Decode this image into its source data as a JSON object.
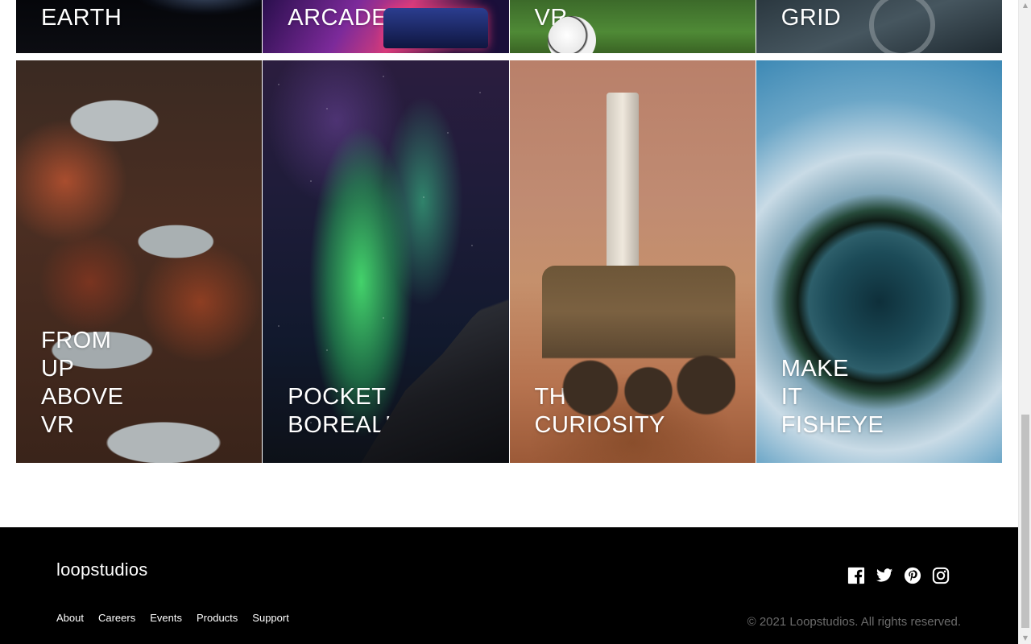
{
  "creations": {
    "top_row": [
      {
        "title": "EARTH"
      },
      {
        "title": "ARCADE"
      },
      {
        "title": "VR"
      },
      {
        "title": "GRID"
      }
    ],
    "main_row": [
      {
        "title": "FROM\nUP\nABOVE\nVR"
      },
      {
        "title": "POCKET\nBOREALIS"
      },
      {
        "title": "THE\nCURIOSITY"
      },
      {
        "title": "MAKE\nIT\nFISHEYE"
      }
    ]
  },
  "footer": {
    "brand": "loopstudios",
    "nav": [
      {
        "label": "About"
      },
      {
        "label": "Careers"
      },
      {
        "label": "Events"
      },
      {
        "label": "Products"
      },
      {
        "label": "Support"
      }
    ],
    "social": [
      {
        "icon": "facebook-icon"
      },
      {
        "icon": "twitter-icon"
      },
      {
        "icon": "pinterest-icon"
      },
      {
        "icon": "instagram-icon"
      }
    ],
    "copyright": "© 2021 Loopstudios. All rights reserved."
  },
  "colors": {
    "footer_bg": "#000000",
    "text_light": "#ffffff",
    "copyright": "#6b6b6b"
  }
}
